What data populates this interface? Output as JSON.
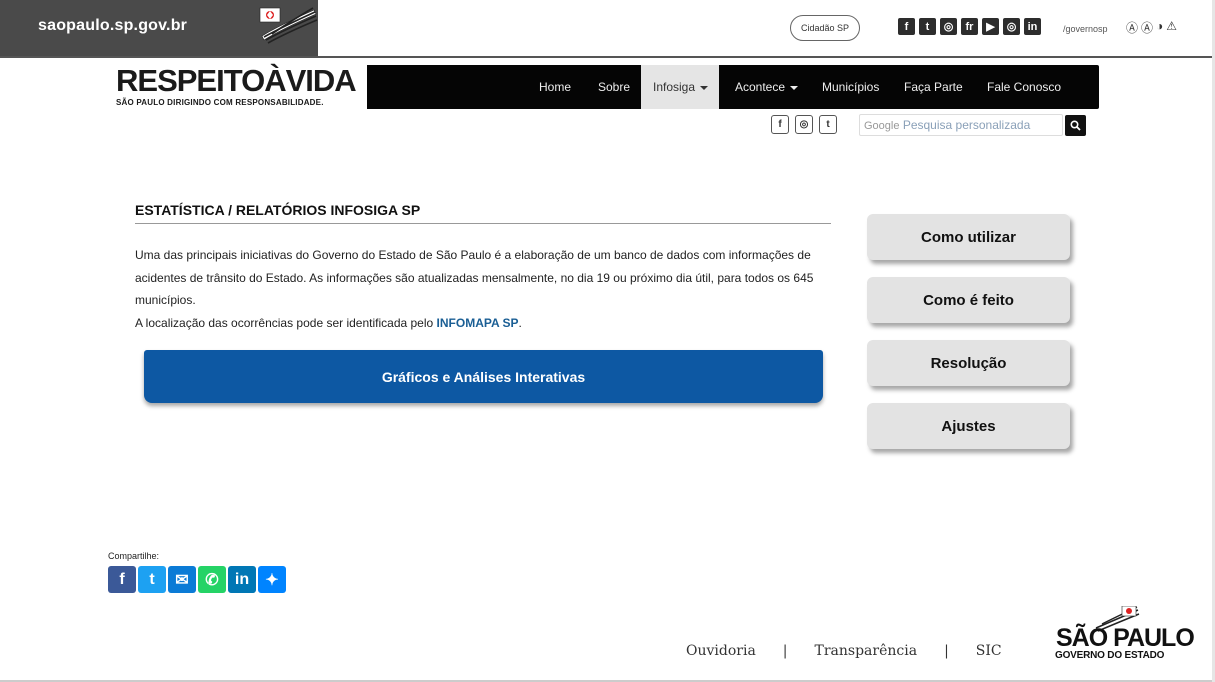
{
  "govbar": {
    "domain": "saopaulo.sp.gov.br",
    "cidadao_label": "Cidadão SP",
    "social_icons": [
      "facebook-icon",
      "twitter-icon",
      "instagram-icon",
      "flickr-icon",
      "youtube-icon",
      "instagram-alt-icon",
      "linkedin-icon"
    ],
    "social_glyphs": [
      "f",
      "t",
      "◎",
      "fr",
      "▶",
      "◎",
      "in"
    ],
    "handle": "/governosp",
    "accessibility_glyphs": [
      "Ⓐ",
      "Ⓐ",
      "◑",
      "⚠"
    ]
  },
  "brand": {
    "title_left": "RESPEITO",
    "title_a": "À",
    "title_right": "VIDA",
    "subtitle": "SÃO PAULO DIRIGINDO COM RESPONSABILIDADE."
  },
  "nav": {
    "items": [
      "Home",
      "Sobre",
      "Infosiga",
      "Acontece",
      "Municípios",
      "Faça Parte",
      "Fale Conosco"
    ],
    "active": "Infosiga"
  },
  "header_social": [
    "f",
    "◎",
    "t"
  ],
  "search": {
    "google_label": "Google",
    "placeholder": "Pesquisa personalizada"
  },
  "main": {
    "title": "ESTATÍSTICA / RELATÓRIOS INFOSIGA SP",
    "paragraph_1": "Uma das principais iniciativas do Governo do Estado de São Paulo é a elaboração de um banco de dados com informações de acidentes de trânsito do Estado. As informações são atualizadas mensalmente, no dia 19 ou próximo dia útil, para todos os 645 municípios.",
    "paragraph_2_prefix": "A localização das ocorrências pode ser identificada pelo ",
    "paragraph_2_link": "INFOMAPA SP",
    "paragraph_2_suffix": ".",
    "cta_label": "Gráficos e Análises Interativas"
  },
  "sidebar": {
    "buttons": [
      "Como utilizar",
      "Como é feito",
      "Resolução",
      "Ajustes"
    ]
  },
  "share": {
    "label": "Compartilhe:",
    "icons": [
      {
        "name": "facebook-share-icon",
        "glyph": "f",
        "color": "#3b5998"
      },
      {
        "name": "twitter-share-icon",
        "glyph": "t",
        "color": "#1da1f2"
      },
      {
        "name": "email-share-icon",
        "glyph": "✉",
        "color": "#0b7bd6"
      },
      {
        "name": "whatsapp-share-icon",
        "glyph": "✆",
        "color": "#25d366"
      },
      {
        "name": "linkedin-share-icon",
        "glyph": "in",
        "color": "#0077b5"
      },
      {
        "name": "messenger-share-icon",
        "glyph": "✦",
        "color": "#0084ff"
      }
    ]
  },
  "footer": {
    "links": [
      "Ouvidoria",
      "Transparência",
      "SIC"
    ],
    "logo_big": "SÃO PAULO",
    "logo_small": "GOVERNO DO ESTADO"
  },
  "colors": {
    "cta_blue": "#0d58a3",
    "link_blue": "#1a5e94",
    "nav_black": "#050505",
    "side_button_gray": "#e3e3e3"
  }
}
